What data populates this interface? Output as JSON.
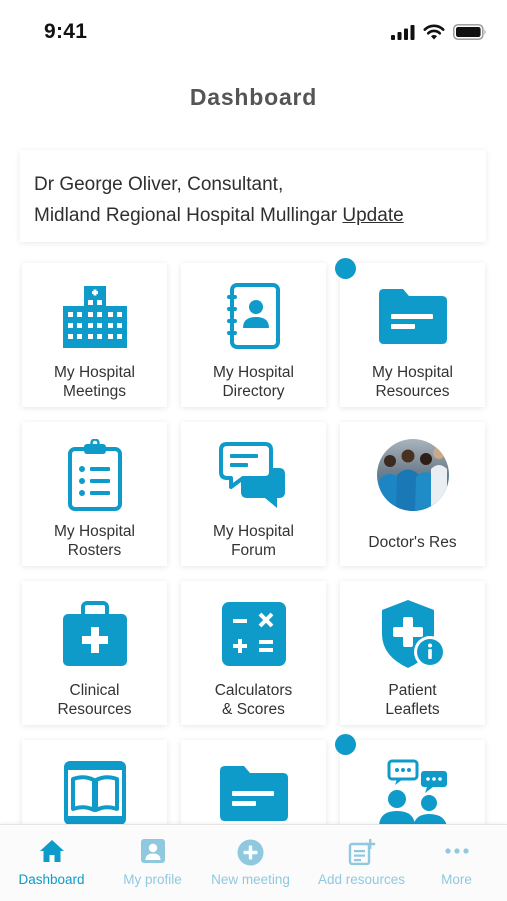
{
  "status_bar": {
    "time": "9:41"
  },
  "header": {
    "title": "Dashboard"
  },
  "user_card": {
    "line1": "Dr George  Oliver, Consultant,",
    "line2": "Midland Regional Hospital Mullingar",
    "update_label": "Update"
  },
  "tiles": [
    {
      "label": "My Hospital\nMeetings",
      "icon": "hospital-building-icon"
    },
    {
      "label": "My Hospital\nDirectory",
      "icon": "contact-book-icon"
    },
    {
      "label": "My Hospital\nResources",
      "icon": "folder-icon"
    },
    {
      "label": "My Hospital\nRosters",
      "icon": "clipboard-list-icon"
    },
    {
      "label": "My Hospital\nForum",
      "icon": "chat-bubbles-icon"
    },
    {
      "label": "Doctor's Res",
      "icon": "doctors-photo"
    },
    {
      "label": "Clinical\nResources",
      "icon": "medical-kit-icon"
    },
    {
      "label": "Calculators\n& Scores",
      "icon": "calculator-icon"
    },
    {
      "label": "Patient\nLeaflets",
      "icon": "shield-info-icon"
    },
    {
      "label": "",
      "icon": "book-icon"
    },
    {
      "label": "",
      "icon": "folder-icon"
    },
    {
      "label": "",
      "icon": "people-chat-icon"
    }
  ],
  "tab_bar": {
    "items": [
      {
        "label": "Dashboard",
        "icon": "home-icon",
        "active": true
      },
      {
        "label": "My profile",
        "icon": "profile-icon",
        "active": false
      },
      {
        "label": "New meeting",
        "icon": "plus-circle-icon",
        "active": false
      },
      {
        "label": "Add resources",
        "icon": "add-document-icon",
        "active": false
      },
      {
        "label": "More",
        "icon": "more-dots-icon",
        "active": false
      }
    ]
  },
  "colors": {
    "accent": "#0f9bc9",
    "inactive_tab": "#8fc9e0"
  }
}
